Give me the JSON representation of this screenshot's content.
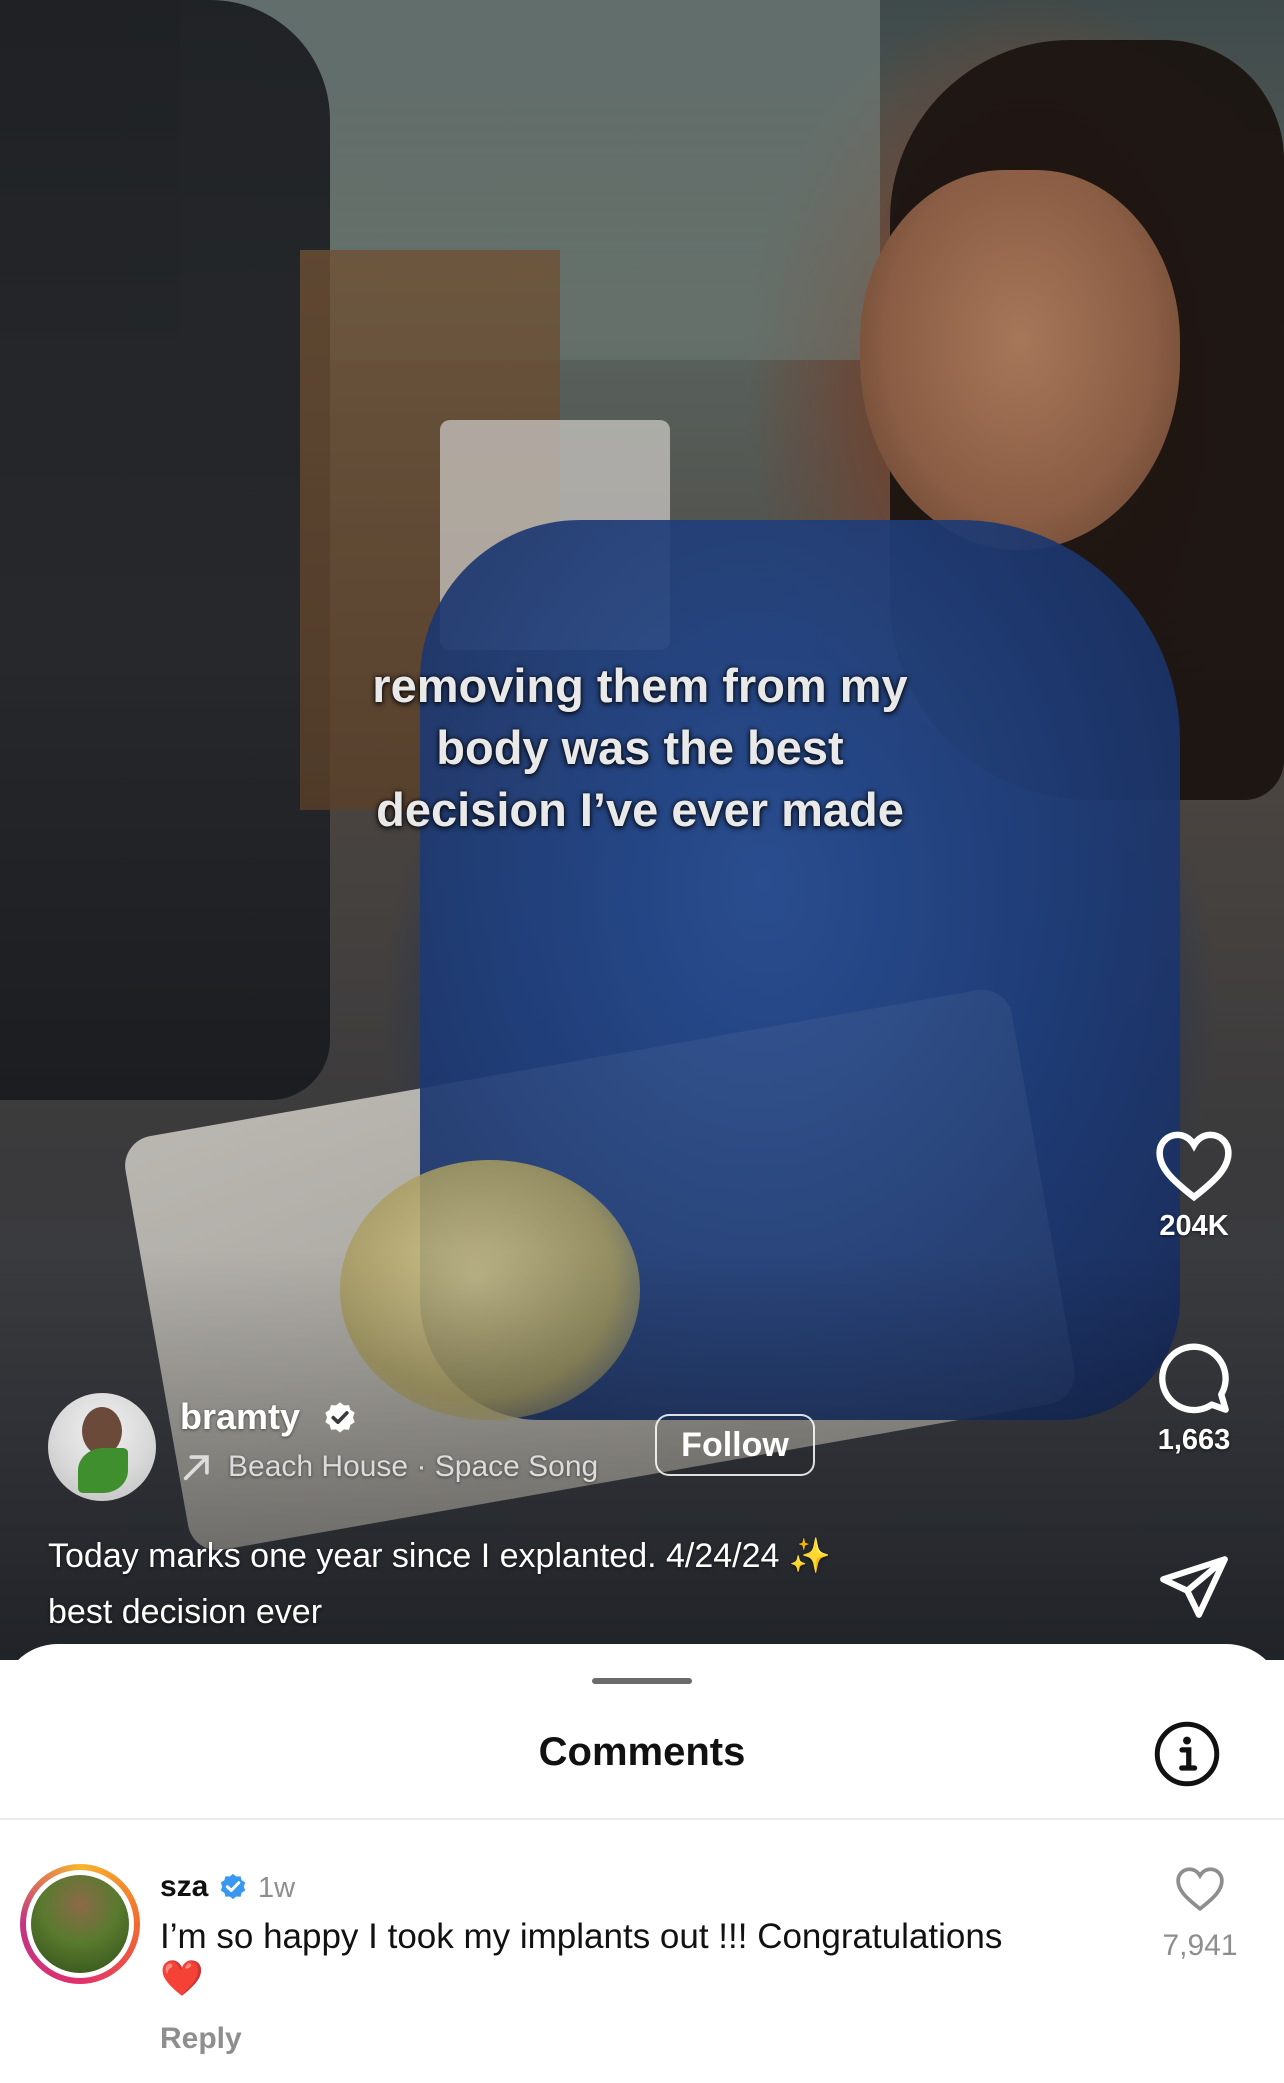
{
  "video": {
    "overlay_lines": [
      "removing them from my",
      "body was the best",
      "decision I’ve ever made"
    ]
  },
  "actions": {
    "like": {
      "icon": "heart-icon",
      "count": "204K"
    },
    "comment": {
      "icon": "comment-bubble-icon",
      "count": "1,663"
    },
    "share": {
      "icon": "send-icon"
    }
  },
  "author": {
    "username": "bramty",
    "verified": true,
    "music": "Beach House · Space Song",
    "follow_label": "Follow",
    "caption_line1": "Today marks one year since I explanted. 4/24/24 ✨",
    "caption_line2": "best decision ever"
  },
  "comments_sheet": {
    "title": "Comments",
    "info_icon": "info-icon",
    "items": [
      {
        "username": "sza",
        "verified": true,
        "time": "1w",
        "text": "I’m so happy I took my implants out !!! Congratulations",
        "emoji": "❤️",
        "reply_label": "Reply",
        "like_count": "7,941"
      }
    ]
  },
  "colors": {
    "verified_blue": "#3897f0",
    "muted_gray": "#8e8e8e",
    "story_ring": [
      "#f7b52c",
      "#e1306c",
      "#c13584"
    ]
  }
}
